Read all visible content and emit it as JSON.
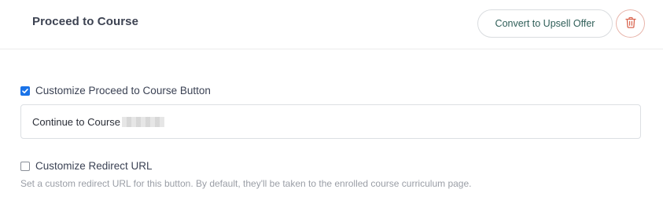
{
  "header": {
    "title": "Proceed to Course",
    "upsell_label": "Convert to Upsell Offer",
    "delete_icon": "trash-icon"
  },
  "proceed_button": {
    "checkbox_checked": true,
    "label": "Customize Proceed to Course Button",
    "input_value": "Continue to Course"
  },
  "redirect": {
    "checkbox_checked": false,
    "label": "Customize Redirect URL",
    "help": "Set a custom redirect URL for this button. By default, they'll be taken to the enrolled course curriculum page."
  },
  "colors": {
    "checkbox_accent": "#1a73e8",
    "delete_icon": "#d9654f",
    "upsell_text": "#2f5e58"
  }
}
